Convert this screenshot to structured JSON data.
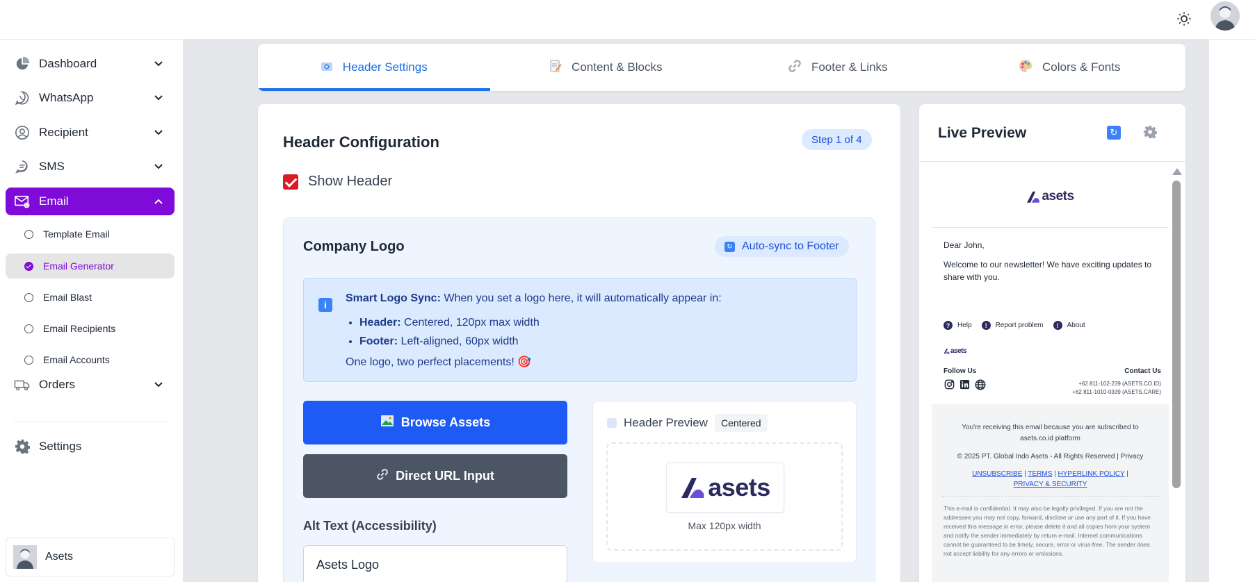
{
  "sidebar": {
    "items": [
      {
        "label": "Dashboard"
      },
      {
        "label": "WhatsApp"
      },
      {
        "label": "Recipient"
      },
      {
        "label": "SMS"
      },
      {
        "label": "Email"
      },
      {
        "label": "Orders"
      },
      {
        "label": "Settings"
      }
    ],
    "email_sub": [
      {
        "label": "Template Email"
      },
      {
        "label": "Email Generator"
      },
      {
        "label": "Email Blast"
      },
      {
        "label": "Email Recipients"
      },
      {
        "label": "Email Accounts"
      }
    ],
    "user": {
      "name": "Asets"
    }
  },
  "tabs": [
    {
      "label": "Header Settings",
      "active": true
    },
    {
      "label": "Content & Blocks"
    },
    {
      "label": "Footer & Links"
    },
    {
      "label": "Colors & Fonts"
    }
  ],
  "config": {
    "title": "Header Configuration",
    "step": "Step 1 of 4",
    "show_header_label": "Show Header",
    "show_header_checked": true,
    "logo_section": {
      "title": "Company Logo",
      "sync_badge": "Auto-sync to Footer",
      "info": {
        "lead_bold": "Smart Logo Sync:",
        "lead_text": " When you set a logo here, it will automatically appear in:",
        "items": [
          {
            "bold": "Header:",
            "text": " Centered, 120px max width"
          },
          {
            "bold": "Footer:",
            "text": " Left-aligned, 60px width"
          }
        ],
        "closing": "One logo, two perfect placements! 🎯"
      },
      "browse_label": "Browse Assets",
      "url_label": "Direct URL Input",
      "alt_label": "Alt Text (Accessibility)",
      "alt_value": "Asets Logo",
      "preview": {
        "title": "Header Preview",
        "alignment": "Centered",
        "max_width": "Max 120px width"
      }
    }
  },
  "brand": {
    "logo_text": "asets",
    "color": "#2d2a5e"
  },
  "live_preview": {
    "title": "Live Preview",
    "email": {
      "greeting": "Dear John,",
      "welcome": "Welcome to our newsletter! We have exciting updates to share with you.",
      "links": [
        {
          "label": "Help",
          "icon": "help-icon"
        },
        {
          "label": "Report problem",
          "icon": "alert-icon"
        },
        {
          "label": "About",
          "icon": "info-icon"
        }
      ],
      "follow_us": "Follow Us",
      "contact_us": "Contact Us",
      "phone1": "+62 811-102-239 (ASETS.CO.ID)",
      "phone2": "+62 811-1010-0339 (ASETS.CARE)",
      "receiving": "You're receiving this email because you are subscribed to",
      "receiving_site": "asets.co.id",
      "receiving_tail": " platform",
      "copyright": "© 2025 PT. Global Indo Asets - All Rights Reserved | Privacy",
      "policy_links": [
        "UNSUBSCRIBE",
        "TERMS",
        "HYPERLINK POLICY",
        "PRIVACY & SECURITY"
      ],
      "confidential": "This e-mail is confidential. It may also be legally privileged. If you are not the addressee you may not copy, forward, disclose or use any part of it. If you have received this message in error, please delete it and all copies from your system and notify the sender immediately by return e-mail. Internet communications cannot be guaranteed to be timely, secure, error or virus-free. The sender does not accept liability for any errors or omissions."
    }
  },
  "colors": {
    "accent": "#7e0bd8",
    "primary_blue": "#1e5bf5",
    "tab_active": "#1d6ee8",
    "checkbox": "#d81b24"
  }
}
